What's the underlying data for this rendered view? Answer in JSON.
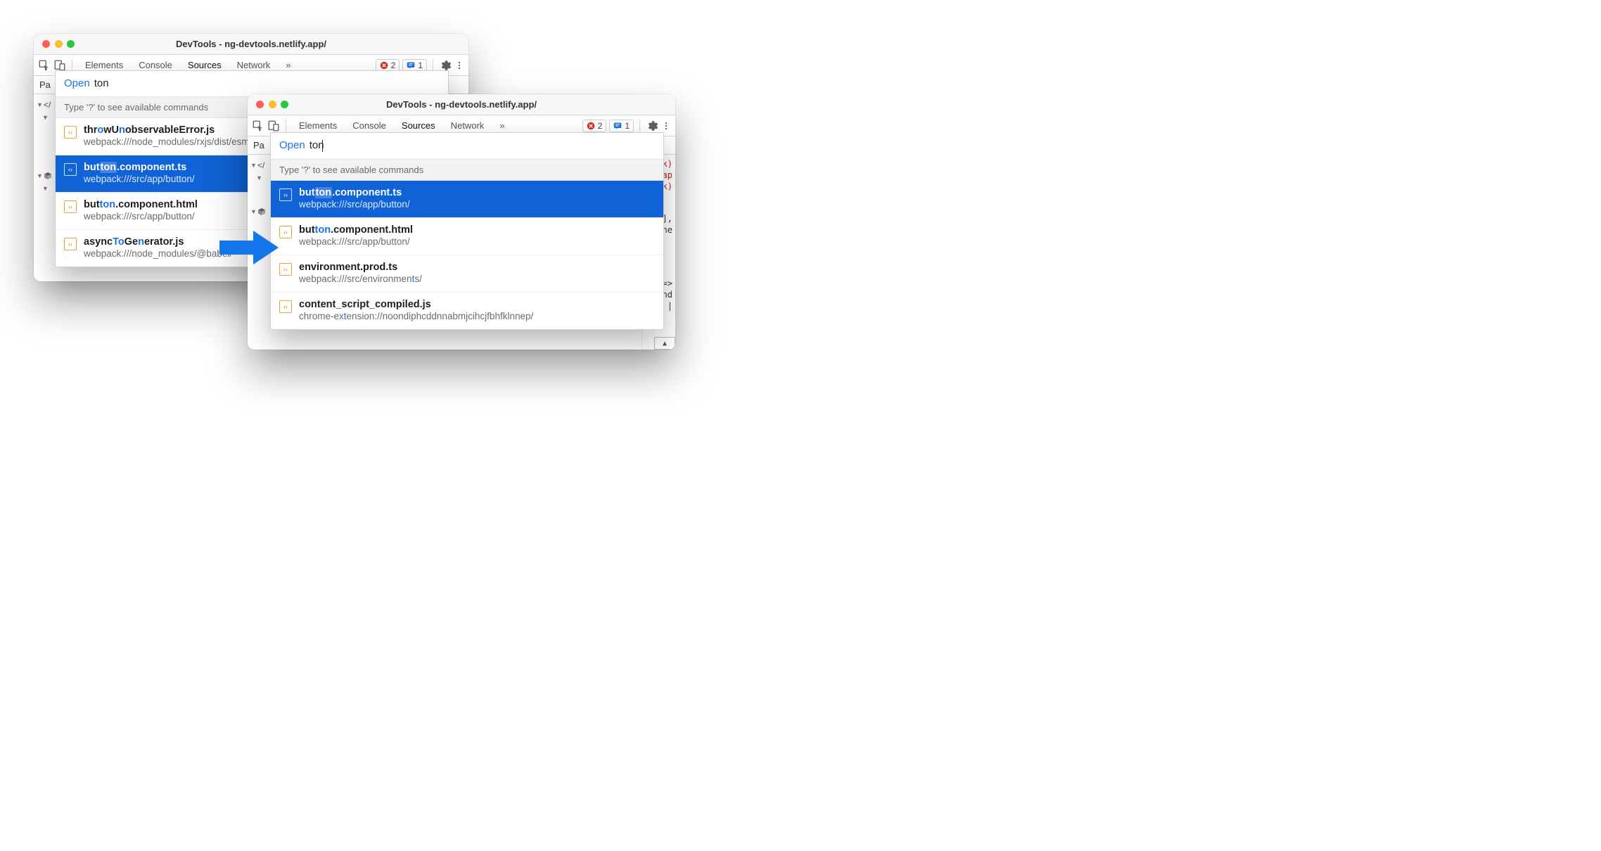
{
  "windows": {
    "left": {
      "title": "DevTools - ng-devtools.netlify.app/",
      "tabs": [
        "Elements",
        "Console",
        "Sources",
        "Network"
      ],
      "active_tab": "Sources",
      "errors": "2",
      "messages": "1",
      "subbar": "Pa"
    },
    "right": {
      "title": "DevTools - ng-devtools.netlify.app/",
      "tabs": [
        "Elements",
        "Console",
        "Sources",
        "Network"
      ],
      "active_tab": "Sources",
      "errors": "2",
      "messages": "1",
      "subbar": "Pa"
    }
  },
  "open": {
    "label": "Open",
    "query": "ton"
  },
  "hint": "Type '?' to see available commands",
  "results_left": [
    {
      "name_parts": [
        [
          "t",
          0
        ],
        [
          "hr",
          0
        ],
        [
          "o",
          1
        ],
        [
          "w",
          0
        ],
        [
          "U",
          0
        ],
        [
          "n",
          1
        ],
        [
          "observableError.js",
          0
        ]
      ],
      "path_parts": [
        [
          "webpack:///node_modules/rxjs/dist/esm",
          0
        ]
      ],
      "selected": false
    },
    {
      "name_parts": [
        [
          "but",
          0
        ],
        [
          "ton",
          1
        ],
        [
          ".component.ts",
          0
        ]
      ],
      "path_parts": [
        [
          "webpack:///src/app/button/",
          0
        ]
      ],
      "selected": true
    },
    {
      "name_parts": [
        [
          "but",
          0
        ],
        [
          "ton",
          1
        ],
        [
          ".component.html",
          0
        ]
      ],
      "path_parts": [
        [
          "webpack:///src/app/button/",
          0
        ]
      ],
      "selected": false
    },
    {
      "name_parts": [
        [
          "async",
          0
        ],
        [
          "To",
          1
        ],
        [
          "Ge",
          0
        ],
        [
          "n",
          1
        ],
        [
          "erator.js",
          0
        ]
      ],
      "path_parts": [
        [
          "webpack:///node_modules/@babel/",
          0
        ]
      ],
      "selected": false
    }
  ],
  "results_right": [
    {
      "name_parts": [
        [
          "but",
          0
        ],
        [
          "ton",
          1
        ],
        [
          ".component.ts",
          0
        ]
      ],
      "path_parts": [
        [
          "webpack:///src/app/button/",
          0
        ]
      ],
      "selected": true
    },
    {
      "name_parts": [
        [
          "but",
          0
        ],
        [
          "ton",
          1
        ],
        [
          ".component.html",
          0
        ]
      ],
      "path_parts": [
        [
          "webpack:///src/app/button/",
          0
        ]
      ],
      "selected": false
    },
    {
      "name_parts": [
        [
          "environment.prod.ts",
          0
        ]
      ],
      "path_parts": [
        [
          "webpack:///src/environmen",
          0
        ],
        [
          "t",
          1
        ],
        [
          "s/",
          0
        ]
      ],
      "selected": false
    },
    {
      "name_parts": [
        [
          "content_script_compiled.js",
          0
        ]
      ],
      "path_parts": [
        [
          "chrome-ex",
          0
        ],
        [
          "t",
          1
        ],
        [
          "ension://noondiphcddnnabmjcihcjfbhfklnnep/",
          0
        ]
      ],
      "selected": false
    }
  ],
  "code_frag": {
    "l1": "ick)",
    "l2": "</ap",
    "l3": "ick)",
    "l4": "],",
    "l5": "None",
    "l6": "=>",
    "l7": "rand",
    "l8": "+x |"
  }
}
